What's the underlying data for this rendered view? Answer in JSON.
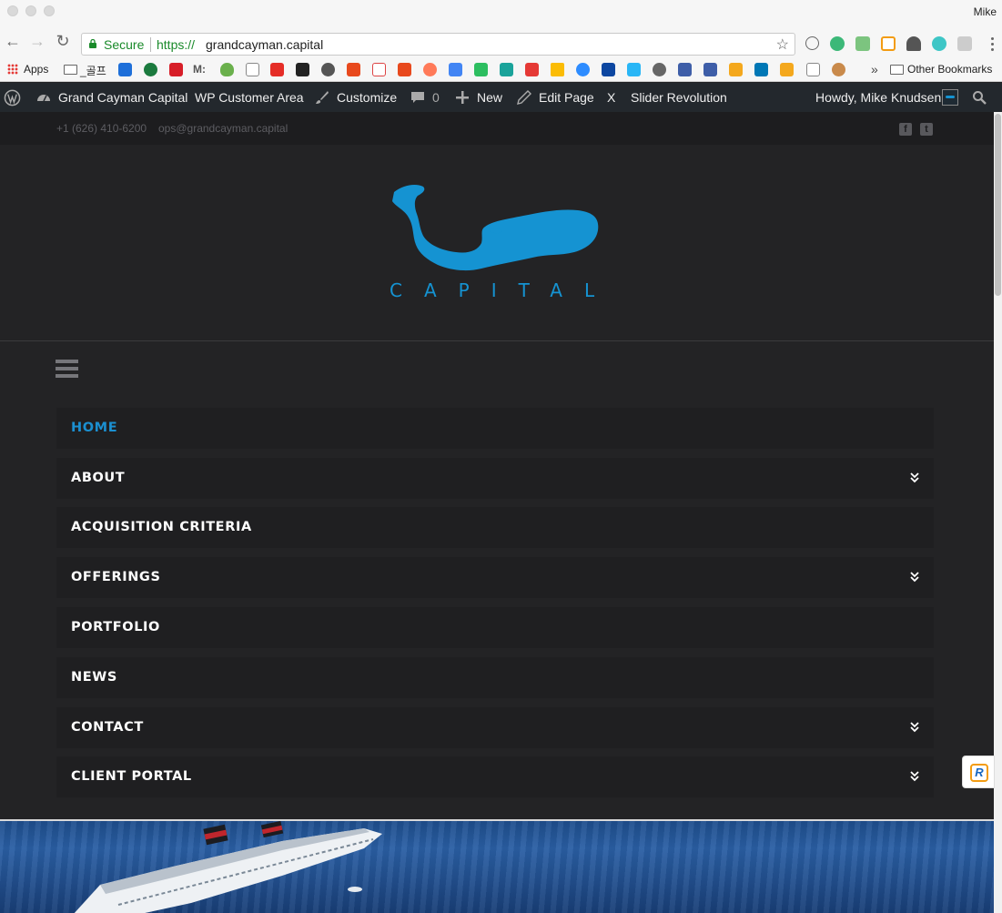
{
  "browser": {
    "profile_name": "Mike",
    "secure_label": "Secure",
    "url_scheme": "https://",
    "url_host": "grandcayman.capital"
  },
  "bookmarks": {
    "apps_label": "Apps",
    "folder_label": "_골프",
    "m_label": "M:",
    "overflow_label": "»",
    "other_label": "Other Bookmarks"
  },
  "wp_admin_bar": {
    "site_name": "Grand Cayman Capital",
    "customer_area": "WP Customer Area",
    "customize": "Customize",
    "comments_count": "0",
    "new_label": "New",
    "edit_page": "Edit Page",
    "x_label": "X",
    "slider_revolution": "Slider Revolution",
    "howdy": "Howdy, Mike Knudsen"
  },
  "site": {
    "phone": "+1 (626) 410-6200",
    "email": "ops@grandcayman.capital",
    "logo_word": "CAPITAL",
    "accent_color": "#1593d2"
  },
  "nav": {
    "items": [
      {
        "label": "HOME",
        "active": true,
        "has_submenu": false
      },
      {
        "label": "ABOUT",
        "active": false,
        "has_submenu": true
      },
      {
        "label": "ACQUISITION CRITERIA",
        "active": false,
        "has_submenu": false
      },
      {
        "label": "OFFERINGS",
        "active": false,
        "has_submenu": true
      },
      {
        "label": "PORTFOLIO",
        "active": false,
        "has_submenu": false
      },
      {
        "label": "NEWS",
        "active": false,
        "has_submenu": false
      },
      {
        "label": "CONTACT",
        "active": false,
        "has_submenu": true
      },
      {
        "label": "CLIENT PORTAL",
        "active": false,
        "has_submenu": true
      }
    ]
  }
}
